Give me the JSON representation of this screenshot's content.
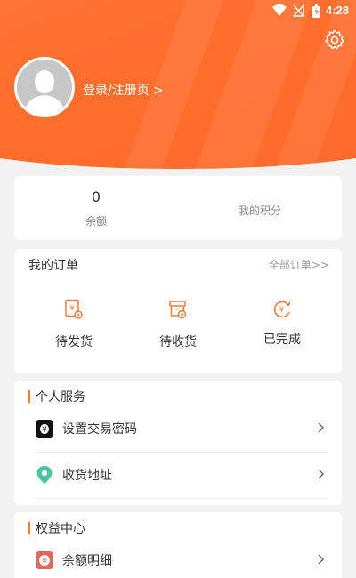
{
  "status_bar": {
    "time": "4:28"
  },
  "header": {
    "login_label": "登录/注册页 >"
  },
  "balance": {
    "value": "0",
    "label": "余额",
    "points_label": "我的积分"
  },
  "orders": {
    "title": "我的订单",
    "all_label": "全部订单>>",
    "items": [
      {
        "label": "待发货",
        "icon": "pending-shipment-icon"
      },
      {
        "label": "待收货",
        "icon": "pending-receipt-icon"
      },
      {
        "label": "已完成",
        "icon": "completed-icon"
      }
    ]
  },
  "services": {
    "title": "个人服务",
    "items": [
      {
        "label": "设置交易密码",
        "icon": "password-icon"
      },
      {
        "label": "收货地址",
        "icon": "location-icon"
      }
    ]
  },
  "rights": {
    "title": "权益中心",
    "items": [
      {
        "label": "余额明细",
        "icon": "balance-detail-icon"
      }
    ]
  },
  "colors": {
    "accent": "#ff6f2e",
    "background": "#f2f2f2",
    "location": "#4cc3a1",
    "balance_detail": "#e0675f"
  }
}
